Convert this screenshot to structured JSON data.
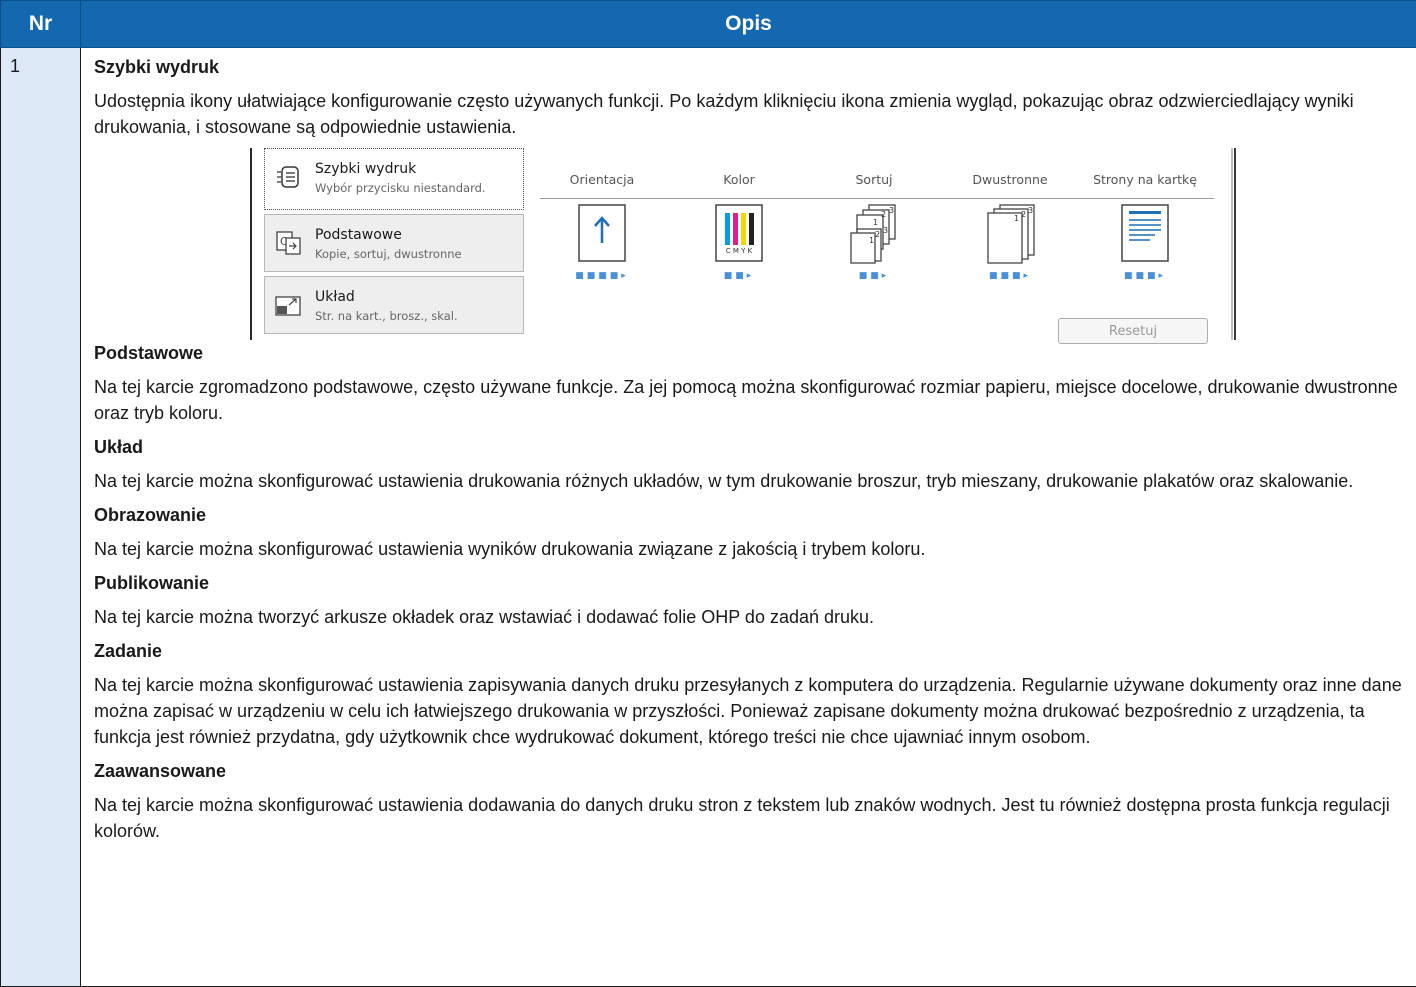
{
  "header": {
    "nr": "Nr",
    "opis": "Opis"
  },
  "row": {
    "nr": "1",
    "sections": [
      {
        "title": "Szybki wydruk",
        "text": "Udostępnia ikony ułatwiające konfigurowanie często używanych funkcji. Po każdym kliknięciu ikona zmienia wygląd, pokazując obraz odzwierciedlający wyniki drukowania, i stosowane są odpowiednie ustawienia."
      },
      {
        "title": "Podstawowe",
        "text": "Na tej karcie zgromadzono podstawowe, często używane funkcje. Za jej pomocą można skonfigurować rozmiar papieru, miejsce docelowe, drukowanie dwustronne oraz tryb koloru."
      },
      {
        "title": "Układ",
        "text": "Na tej karcie można skonfigurować ustawienia drukowania różnych układów, w tym drukowanie broszur, tryb mieszany, drukowanie plakatów oraz skalowanie."
      },
      {
        "title": "Obrazowanie",
        "text": "Na tej karcie można skonfigurować ustawienia wyników drukowania związane z jakością i trybem koloru."
      },
      {
        "title": "Publikowanie",
        "text": "Na tej karcie można tworzyć arkusze okładek oraz wstawiać i dodawać folie OHP do zadań druku."
      },
      {
        "title": "Zadanie",
        "text": "Na tej karcie można skonfigurować ustawienia zapisywania danych druku przesyłanych z komputera do urządzenia. Regularnie używane dokumenty oraz inne dane można zapisać w urządzeniu w celu ich łatwiejszego drukowania w przyszłości. Ponieważ zapisane dokumenty można drukować bezpośrednio z urządzenia, ta funkcja jest również przydatna, gdy użytkownik chce wydrukować dokument, którego treści nie chce ujawniać innym osobom."
      },
      {
        "title": "Zaawansowane",
        "text": "Na tej karcie można skonfigurować ustawienia dodawania do danych druku stron z tekstem lub znaków wodnych. Jest tu również dostępna prosta funkcja regulacji kolorów."
      }
    ]
  },
  "screenshot": {
    "tabs": [
      {
        "title": "Szybki wydruk",
        "subtitle": "Wybór przycisku niestandard.",
        "icon": "quick-print-icon"
      },
      {
        "title": "Podstawowe",
        "subtitle": "Kopie, sortuj, dwustronne",
        "icon": "basic-copy-icon"
      },
      {
        "title": "Układ",
        "subtitle": "Str. na kart., brosz., skal.",
        "icon": "layout-icon"
      }
    ],
    "columns": [
      "Orientacja",
      "Kolor",
      "Sortuj",
      "Dwustronne",
      "Strony na kartkę"
    ],
    "cmyk_label": "C M Y K",
    "reset_label": "Resetuj"
  }
}
